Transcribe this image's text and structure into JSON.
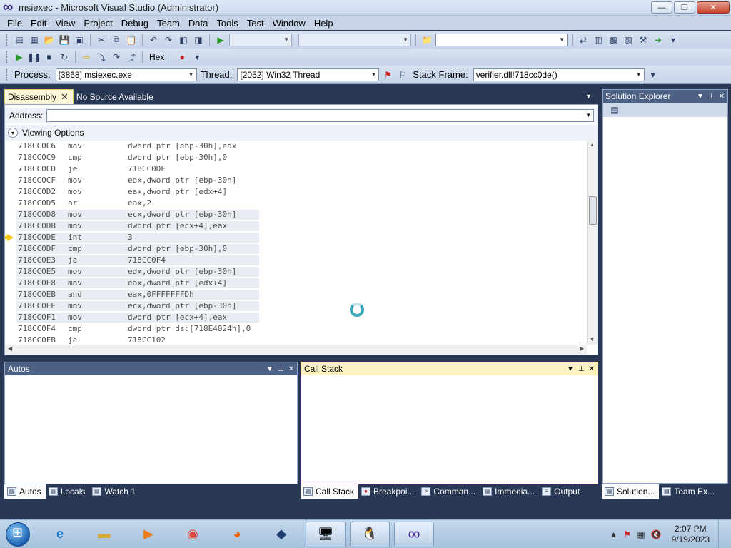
{
  "window": {
    "title": "msiexec - Microsoft Visual Studio (Administrator)",
    "btn_minimize": "—",
    "btn_restore": "❐",
    "btn_close": "✕"
  },
  "menu": [
    "File",
    "Edit",
    "View",
    "Project",
    "Debug",
    "Team",
    "Data",
    "Tools",
    "Test",
    "Window",
    "Help"
  ],
  "debug_toolbar": {
    "hex_label": "Hex"
  },
  "location_bar": {
    "process_label": "Process:",
    "process_value": "[3868] msiexec.exe",
    "thread_label": "Thread:",
    "thread_value": "[2052] Win32 Thread",
    "stack_frame_label": "Stack Frame:",
    "stack_frame_value": "verifier.dll!718cc0de()"
  },
  "doc_tabs": [
    {
      "label": "Disassembly",
      "active": true,
      "close": "✕"
    },
    {
      "label": "No Source Available",
      "active": false
    }
  ],
  "disassembly": {
    "address_label": "Address:",
    "address_value": "",
    "viewing_options_label": "Viewing Options",
    "lines": [
      {
        "addr": "718CC0C6",
        "mnemonic": "mov",
        "operands": "dword ptr [ebp-30h],eax",
        "highlight": false,
        "current": false
      },
      {
        "addr": "718CC0C9",
        "mnemonic": "cmp",
        "operands": "dword ptr [ebp-30h],0",
        "highlight": false,
        "current": false
      },
      {
        "addr": "718CC0CD",
        "mnemonic": "je",
        "operands": "718CC0DE",
        "highlight": false,
        "current": false
      },
      {
        "addr": "718CC0CF",
        "mnemonic": "mov",
        "operands": "edx,dword ptr [ebp-30h]",
        "highlight": false,
        "current": false
      },
      {
        "addr": "718CC0D2",
        "mnemonic": "mov",
        "operands": "eax,dword ptr [edx+4]",
        "highlight": false,
        "current": false
      },
      {
        "addr": "718CC0D5",
        "mnemonic": "or",
        "operands": "eax,2",
        "highlight": false,
        "current": false
      },
      {
        "addr": "718CC0D8",
        "mnemonic": "mov",
        "operands": "ecx,dword ptr [ebp-30h]",
        "highlight": true,
        "current": false
      },
      {
        "addr": "718CC0DB",
        "mnemonic": "mov",
        "operands": "dword ptr [ecx+4],eax",
        "highlight": true,
        "current": false
      },
      {
        "addr": "718CC0DE",
        "mnemonic": "int",
        "operands": "3",
        "highlight": true,
        "current": true
      },
      {
        "addr": "718CC0DF",
        "mnemonic": "cmp",
        "operands": "dword ptr [ebp-30h],0",
        "highlight": true,
        "current": false
      },
      {
        "addr": "718CC0E3",
        "mnemonic": "je",
        "operands": "718CC0F4",
        "highlight": true,
        "current": false
      },
      {
        "addr": "718CC0E5",
        "mnemonic": "mov",
        "operands": "edx,dword ptr [ebp-30h]",
        "highlight": true,
        "current": false
      },
      {
        "addr": "718CC0E8",
        "mnemonic": "mov",
        "operands": "eax,dword ptr [edx+4]",
        "highlight": true,
        "current": false
      },
      {
        "addr": "718CC0EB",
        "mnemonic": "and",
        "operands": "eax,0FFFFFFFDh",
        "highlight": true,
        "current": false
      },
      {
        "addr": "718CC0EE",
        "mnemonic": "mov",
        "operands": "ecx,dword ptr [ebp-30h]",
        "highlight": true,
        "current": false
      },
      {
        "addr": "718CC0F1",
        "mnemonic": "mov",
        "operands": "dword ptr [ecx+4],eax",
        "highlight": true,
        "current": false
      },
      {
        "addr": "718CC0F4",
        "mnemonic": "cmp",
        "operands": "dword ptr ds:[718E4024h],0",
        "highlight": false,
        "current": false
      },
      {
        "addr": "718CC0FB",
        "mnemonic": "je",
        "operands": "718CC102",
        "highlight": false,
        "current": false
      }
    ]
  },
  "solution_explorer": {
    "title": "Solution Explorer"
  },
  "autos": {
    "title": "Autos"
  },
  "call_stack": {
    "title": "Call Stack"
  },
  "left_bottom_tabs": [
    "Autos",
    "Locals",
    "Watch 1"
  ],
  "mid_bottom_tabs": [
    "Call Stack",
    "Breakpoi...",
    "Comman...",
    "Immedia...",
    "Output"
  ],
  "right_bottom_tabs": [
    "Solution...",
    "Team Ex..."
  ],
  "taskbar": {
    "apps": [
      "internet-explorer",
      "file-explorer",
      "media-player",
      "chrome",
      "firefox",
      "network-app",
      "setup-app",
      "linux-app",
      "visual-studio"
    ],
    "clock_time": "2:07 PM",
    "clock_date": "9/19/2023"
  }
}
